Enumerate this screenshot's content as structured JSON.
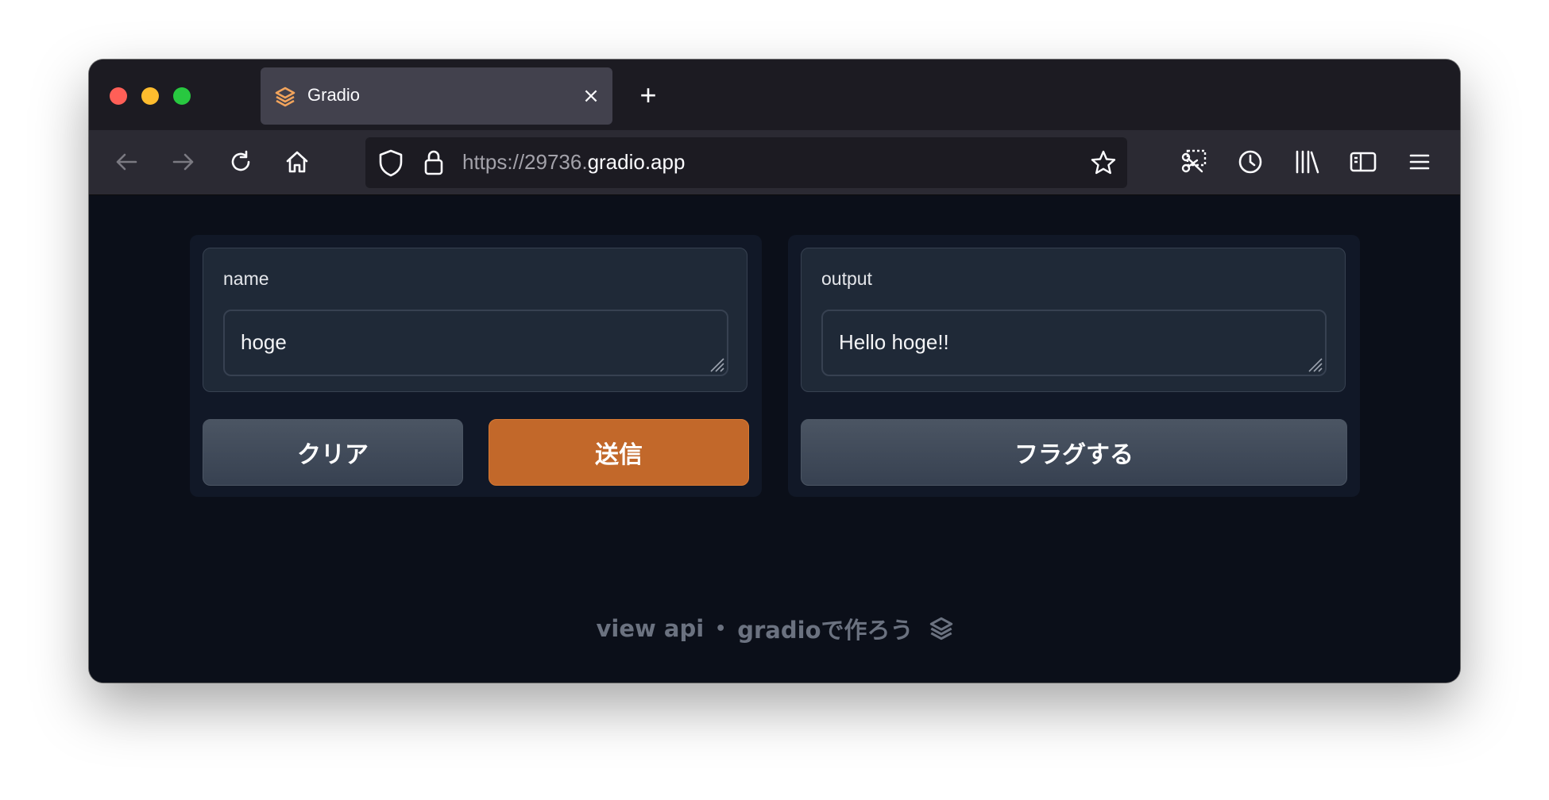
{
  "browser": {
    "tab_title": "Gradio",
    "close_glyph": "×",
    "new_tab_glyph": "+",
    "url_prefix": "https://29736.",
    "url_domain": "gradio.app"
  },
  "left_panel": {
    "input_label": "name",
    "input_value": "hoge",
    "clear_button": "クリア",
    "submit_button": "送信"
  },
  "right_panel": {
    "output_label": "output",
    "output_value": "Hello hoge!!",
    "flag_button": "フラグする"
  },
  "footer": {
    "api_link": "view api",
    "separator": "•",
    "built_with": "gradioで作ろう"
  },
  "colors": {
    "primary_button": "#c2682a",
    "page_background": "#0b0f19"
  }
}
